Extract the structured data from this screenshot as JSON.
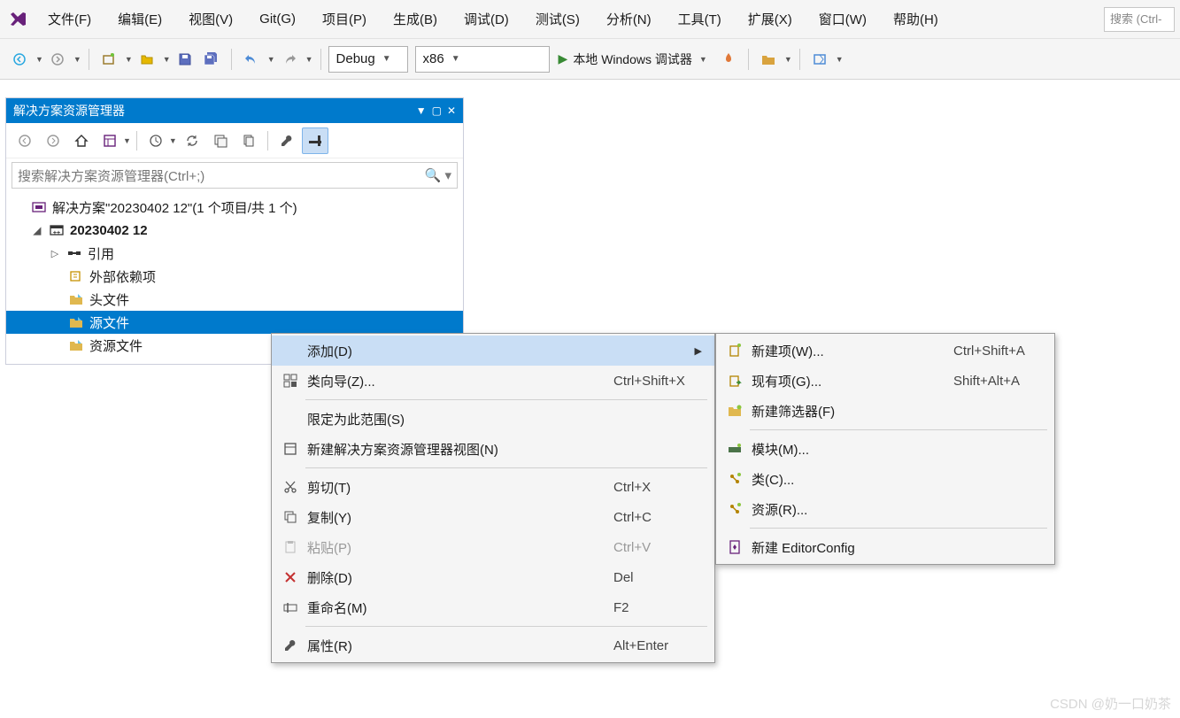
{
  "menubar": {
    "items": [
      "文件(F)",
      "编辑(E)",
      "视图(V)",
      "Git(G)",
      "项目(P)",
      "生成(B)",
      "调试(D)",
      "测试(S)",
      "分析(N)",
      "工具(T)",
      "扩展(X)",
      "窗口(W)",
      "帮助(H)"
    ],
    "search_placeholder": "搜索 (Ctrl-"
  },
  "toolbar": {
    "config": "Debug",
    "platform": "x86",
    "run_label": "本地 Windows 调试器"
  },
  "sln": {
    "title": "解决方案资源管理器",
    "search_placeholder": "搜索解决方案资源管理器(Ctrl+;)",
    "root": "解决方案\"20230402 12\"(1 个项目/共 1 个)",
    "project": "20230402 12",
    "nodes": [
      "引用",
      "外部依赖项",
      "头文件",
      "源文件",
      "资源文件"
    ]
  },
  "ctx_main": [
    {
      "icon": "",
      "label": "添加(D)",
      "shortcut": "",
      "sub": true,
      "highlight": true
    },
    {
      "icon": "wizard",
      "label": "类向导(Z)...",
      "shortcut": "Ctrl+Shift+X"
    },
    {
      "sep": true
    },
    {
      "icon": "",
      "label": "限定为此范围(S)",
      "shortcut": ""
    },
    {
      "icon": "newview",
      "label": "新建解决方案资源管理器视图(N)",
      "shortcut": ""
    },
    {
      "sep": true
    },
    {
      "icon": "cut",
      "label": "剪切(T)",
      "shortcut": "Ctrl+X"
    },
    {
      "icon": "copy",
      "label": "复制(Y)",
      "shortcut": "Ctrl+C"
    },
    {
      "icon": "paste",
      "label": "粘贴(P)",
      "shortcut": "Ctrl+V",
      "disabled": true
    },
    {
      "icon": "delete",
      "label": "删除(D)",
      "shortcut": "Del"
    },
    {
      "icon": "rename",
      "label": "重命名(M)",
      "shortcut": "F2"
    },
    {
      "sep": true
    },
    {
      "icon": "wrench",
      "label": "属性(R)",
      "shortcut": "Alt+Enter"
    }
  ],
  "ctx_sub": [
    {
      "icon": "newitem",
      "label": "新建项(W)...",
      "shortcut": "Ctrl+Shift+A"
    },
    {
      "icon": "existitem",
      "label": "现有项(G)...",
      "shortcut": "Shift+Alt+A"
    },
    {
      "icon": "newfilter",
      "label": "新建筛选器(F)",
      "shortcut": ""
    },
    {
      "sep": true
    },
    {
      "icon": "module",
      "label": "模块(M)...",
      "shortcut": ""
    },
    {
      "icon": "class",
      "label": "类(C)...",
      "shortcut": ""
    },
    {
      "icon": "resource",
      "label": "资源(R)...",
      "shortcut": ""
    },
    {
      "sep": true
    },
    {
      "icon": "editorconfig",
      "label": "新建 EditorConfig",
      "shortcut": ""
    }
  ],
  "watermark": "CSDN @奶一口奶茶"
}
